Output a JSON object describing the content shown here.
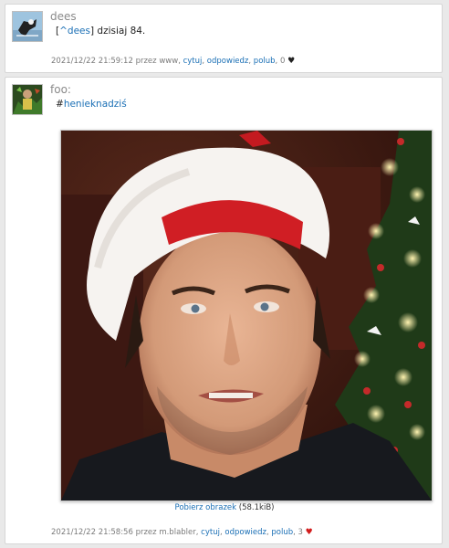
{
  "posts": [
    {
      "author": "dees",
      "body": {
        "open": "[",
        "link": "^dees",
        "rest": "] dzisiaj 84."
      },
      "meta": {
        "datetime": "2021/12/22 21:59:12",
        "by": "przez",
        "user": "www",
        "actions": [
          "cytuj",
          "odpowiedz",
          "polub"
        ],
        "likes": "0"
      }
    },
    {
      "author": "foo:",
      "body": {
        "hash": "#",
        "tag": "henieknadziś"
      },
      "image": {
        "download_label": "Pobierz obrazek",
        "size": "(58.1kiB)"
      },
      "meta": {
        "datetime": "2021/12/22 21:58:56",
        "by": "przez",
        "user": "m.blabler",
        "actions": [
          "cytuj",
          "odpowiedz",
          "polub"
        ],
        "likes": "3"
      }
    }
  ],
  "icons": {
    "heart_black": "heart-icon",
    "heart_red": "heart-icon-red"
  },
  "colors": {
    "link": "#1a6fb5",
    "heart_liked": "#d21c1c"
  }
}
